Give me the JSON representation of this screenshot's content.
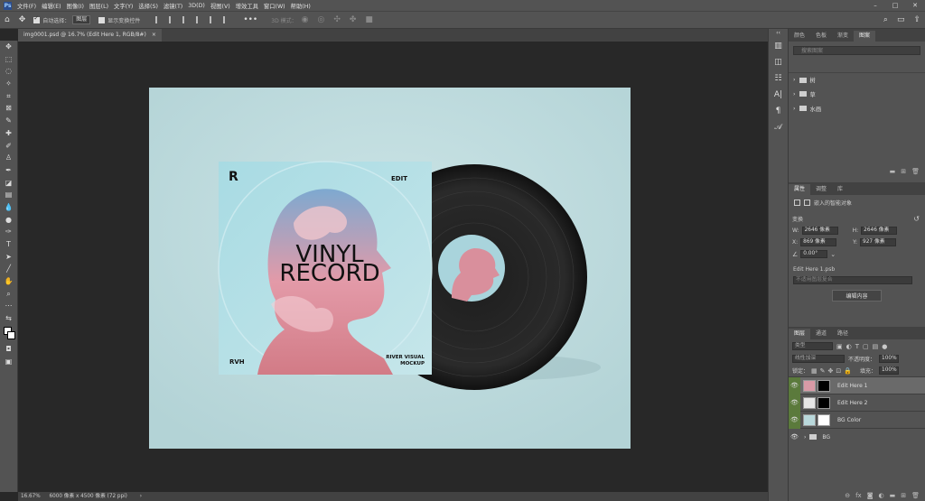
{
  "app": {
    "logo": "Ps"
  },
  "menu": [
    "文件(F)",
    "编辑(E)",
    "图像(I)",
    "图层(L)",
    "文字(Y)",
    "选择(S)",
    "滤镜(T)",
    "3D(D)",
    "视图(V)",
    "增效工具",
    "窗口(W)",
    "帮助(H)"
  ],
  "options": {
    "auto_select": "自动选择：",
    "auto_select_value": "图层",
    "show_transform": "显示变换控件",
    "mode": "3D 模式："
  },
  "tab": {
    "title": "img0001.psd @ 16.7% (Edit Here 1, RGB/8#)",
    "close": "×"
  },
  "status": {
    "zoom": "16.67%",
    "doc": "6000 像素 x 4500 像素 (72 ppi)"
  },
  "artwork": {
    "brand": "EDIT",
    "title1": "VINYL",
    "title2": "RECORD",
    "left": "RVH",
    "right1": "RIVER VISUAL",
    "right2": "MOCKUP"
  },
  "panels": {
    "top_tabs": [
      "颜色",
      "色板",
      "渐变",
      "图案"
    ],
    "search": "搜索图案",
    "folders": [
      "树",
      "草",
      "水画"
    ],
    "props_tabs": [
      "属性",
      "调整",
      "库"
    ],
    "smart": "嵌入的智能对象",
    "transform": "变换",
    "w_label": "W:",
    "w": "2646 像素",
    "h_label": "H:",
    "h": "2646 像素",
    "x_label": "X:",
    "x": "869 像素",
    "y_label": "Y:",
    "y": "927 像素",
    "angle": "0.00°",
    "file": "Edit Here 1.psb",
    "comp": "不适用图层复合",
    "edit_btn": "编辑内容",
    "layer_tabs": [
      "图层",
      "通道",
      "路径"
    ],
    "kind": "类型",
    "blend": "线性加深",
    "opacity_label": "不透明度：",
    "opacity": "100%",
    "lock_label": "锁定：",
    "fill_label": "填充：",
    "fill": "100%",
    "layers": [
      "Edit Here 1",
      "Edit Here 2",
      "BG Color",
      "BG"
    ]
  },
  "colors": {
    "canvas": "#b9d8db",
    "accent": "#5b7a3c"
  }
}
